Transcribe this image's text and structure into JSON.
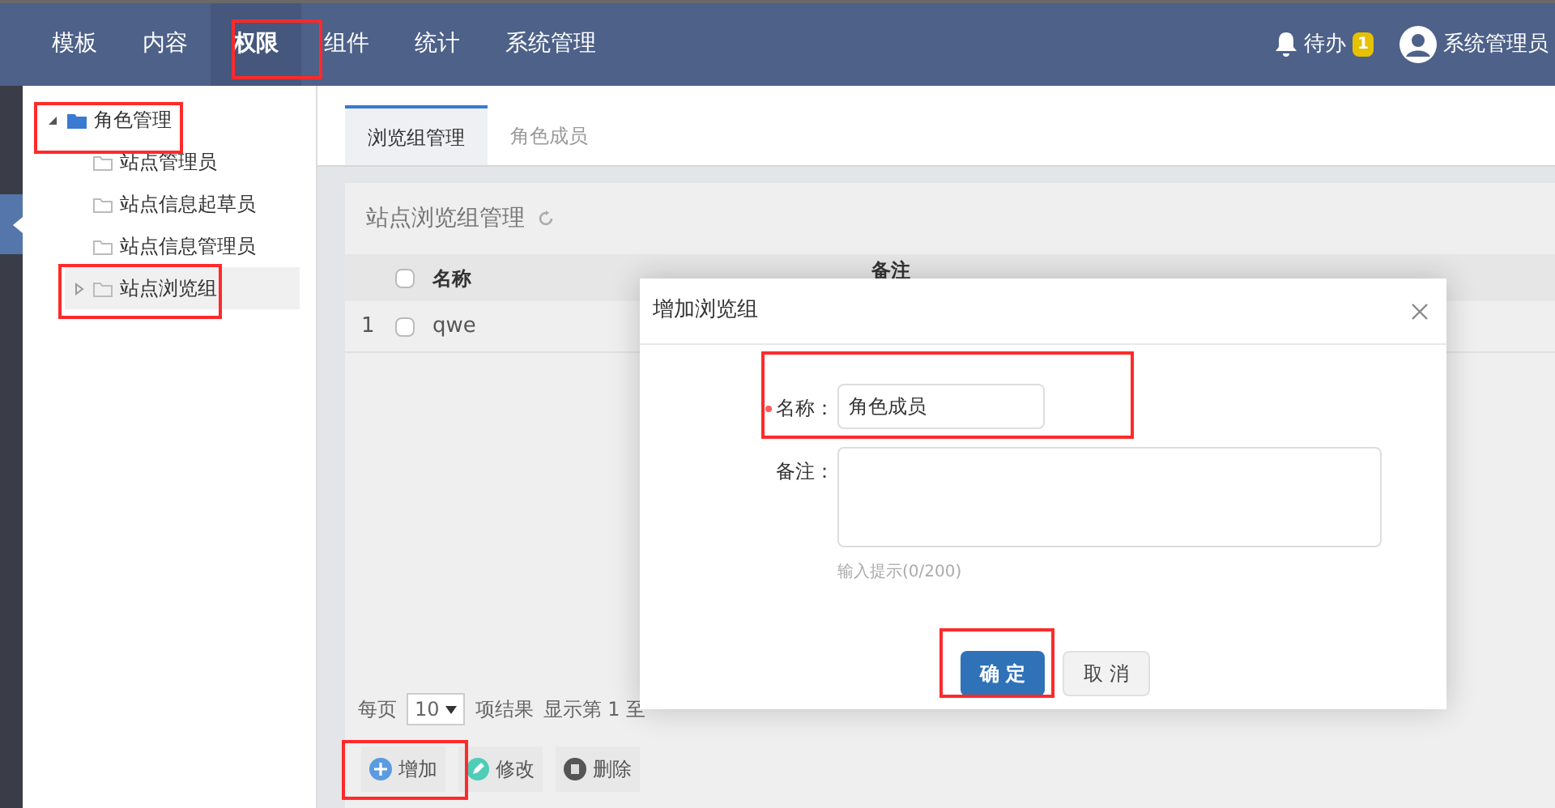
{
  "nav": {
    "items": [
      {
        "label": "模板",
        "selected": false
      },
      {
        "label": "内容",
        "selected": false
      },
      {
        "label": "权限",
        "selected": true
      },
      {
        "label": "组件",
        "selected": false
      },
      {
        "label": "统计",
        "selected": false
      },
      {
        "label": "系统管理",
        "selected": false
      }
    ],
    "todo": {
      "label": "待办",
      "count": "1"
    },
    "user": {
      "name": "系统管理员"
    }
  },
  "sidebar": {
    "tree": [
      {
        "label": "角色管理",
        "kind": "branch",
        "expanded": true,
        "selected": false,
        "children": [
          {
            "label": "站点管理员",
            "kind": "leaf",
            "selected": false
          },
          {
            "label": "站点信息起草员",
            "kind": "leaf",
            "selected": false
          },
          {
            "label": "站点信息管理员",
            "kind": "leaf",
            "selected": false
          },
          {
            "label": "站点浏览组",
            "kind": "branch",
            "expanded": false,
            "selected": true
          }
        ]
      }
    ]
  },
  "tabs": [
    {
      "label": "浏览组管理",
      "selected": true
    },
    {
      "label": "角色成员",
      "selected": false
    }
  ],
  "panel": {
    "title": "站点浏览组管理",
    "table": {
      "header_checked": false,
      "columns": [
        "名称",
        "备注"
      ],
      "rows": [
        {
          "index": "1",
          "checked": false,
          "name": "qwe"
        }
      ]
    },
    "pagination": {
      "per_page_label": "每页",
      "page_size": "10",
      "results_label": "项结果",
      "info": "显示第 1 至"
    },
    "actions": [
      {
        "label": "增加",
        "kind": "add"
      },
      {
        "label": "修改",
        "kind": "edit"
      },
      {
        "label": "删除",
        "kind": "delete"
      }
    ]
  },
  "dialog": {
    "title": "增加浏览组",
    "fields": [
      {
        "label": "名称：",
        "kind": "input",
        "required": true,
        "value": "角色成员"
      },
      {
        "label": "备注：",
        "kind": "textarea",
        "required": false,
        "hint": "输入提示(0/200)"
      }
    ],
    "buttons": [
      {
        "label": "确 定",
        "kind": "primary"
      },
      {
        "label": "取 消",
        "kind": "default"
      }
    ]
  }
}
